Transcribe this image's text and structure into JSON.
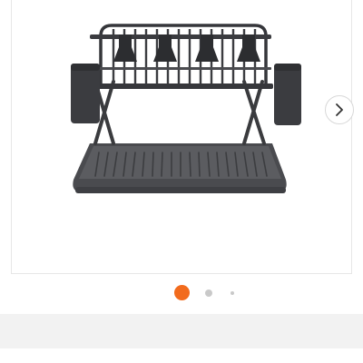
{
  "gallery": {
    "image": {
      "subject_icon": "dish-rack-image"
    },
    "next_button": {
      "icon": "chevron-right-icon",
      "color": "#333333"
    },
    "pagination": {
      "total": 3,
      "active_index": 0,
      "active_color": "#f26b1d",
      "inactive_color": "#c9c9c9"
    }
  },
  "product": {
    "title_peek": ""
  },
  "colors": {
    "band": "#f2f2f2"
  }
}
